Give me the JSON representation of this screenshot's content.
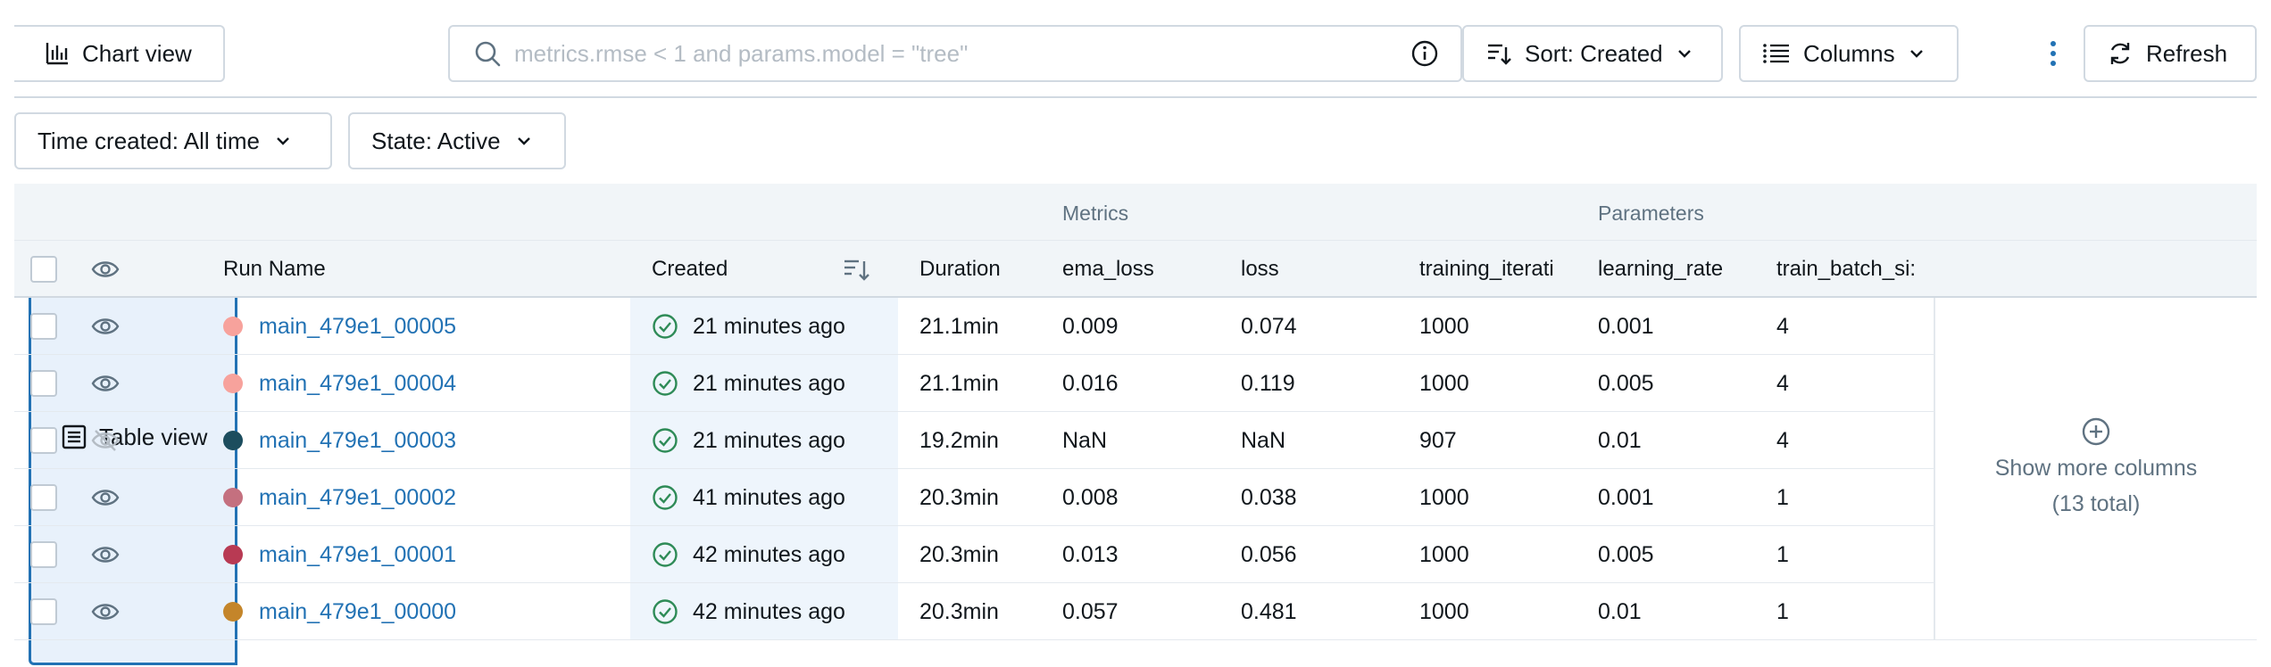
{
  "toolbar": {
    "table_view": "Table view",
    "chart_view": "Chart view",
    "search_placeholder": "metrics.rmse < 1 and params.model = \"tree\"",
    "sort_label": "Sort: Created",
    "columns_label": "Columns",
    "refresh_label": "Refresh"
  },
  "filters": {
    "time_created": "Time created: All time",
    "state": "State: Active"
  },
  "table": {
    "groups": {
      "metrics": "Metrics",
      "parameters": "Parameters"
    },
    "headers": {
      "run_name": "Run Name",
      "created": "Created",
      "duration": "Duration",
      "ema_loss": "ema_loss",
      "loss": "loss",
      "training_iterations": "training_iterati",
      "learning_rate": "learning_rate",
      "train_batch_size": "train_batch_si:"
    },
    "rows": [
      {
        "name": "main_479e1_00005",
        "color": "#f7a29c",
        "visible": true,
        "created": "21 minutes ago",
        "duration": "21.1min",
        "ema_loss": "0.009",
        "loss": "0.074",
        "training_iterations": "1000",
        "learning_rate": "0.001",
        "train_batch_size": "4"
      },
      {
        "name": "main_479e1_00004",
        "color": "#f7a29c",
        "visible": true,
        "created": "21 minutes ago",
        "duration": "21.1min",
        "ema_loss": "0.016",
        "loss": "0.119",
        "training_iterations": "1000",
        "learning_rate": "0.005",
        "train_batch_size": "4"
      },
      {
        "name": "main_479e1_00003",
        "color": "#1c4d5e",
        "visible": false,
        "created": "21 minutes ago",
        "duration": "19.2min",
        "ema_loss": "NaN",
        "loss": "NaN",
        "training_iterations": "907",
        "learning_rate": "0.01",
        "train_batch_size": "4"
      },
      {
        "name": "main_479e1_00002",
        "color": "#c4707f",
        "visible": true,
        "created": "41 minutes ago",
        "duration": "20.3min",
        "ema_loss": "0.008",
        "loss": "0.038",
        "training_iterations": "1000",
        "learning_rate": "0.001",
        "train_batch_size": "1"
      },
      {
        "name": "main_479e1_00001",
        "color": "#b83a53",
        "visible": true,
        "created": "42 minutes ago",
        "duration": "20.3min",
        "ema_loss": "0.013",
        "loss": "0.056",
        "training_iterations": "1000",
        "learning_rate": "0.005",
        "train_batch_size": "1"
      },
      {
        "name": "main_479e1_00000",
        "color": "#c4852a",
        "visible": true,
        "created": "42 minutes ago",
        "duration": "20.3min",
        "ema_loss": "0.057",
        "loss": "0.481",
        "training_iterations": "1000",
        "learning_rate": "0.01",
        "train_batch_size": "1"
      }
    ],
    "show_more_line1": "Show more columns",
    "show_more_line2": "(13 total)"
  },
  "colors": {
    "accent": "#2272b4",
    "success": "#2e8b57",
    "border": "#d1d9e1"
  },
  "icons": [
    "table-icon",
    "bar-chart-icon",
    "search-icon",
    "info-icon",
    "sort-icon",
    "list-icon",
    "chevron-down-icon",
    "kebab-icon",
    "refresh-icon",
    "eye-icon",
    "eye-off-icon",
    "check-circle-icon",
    "plus-circle-icon"
  ]
}
